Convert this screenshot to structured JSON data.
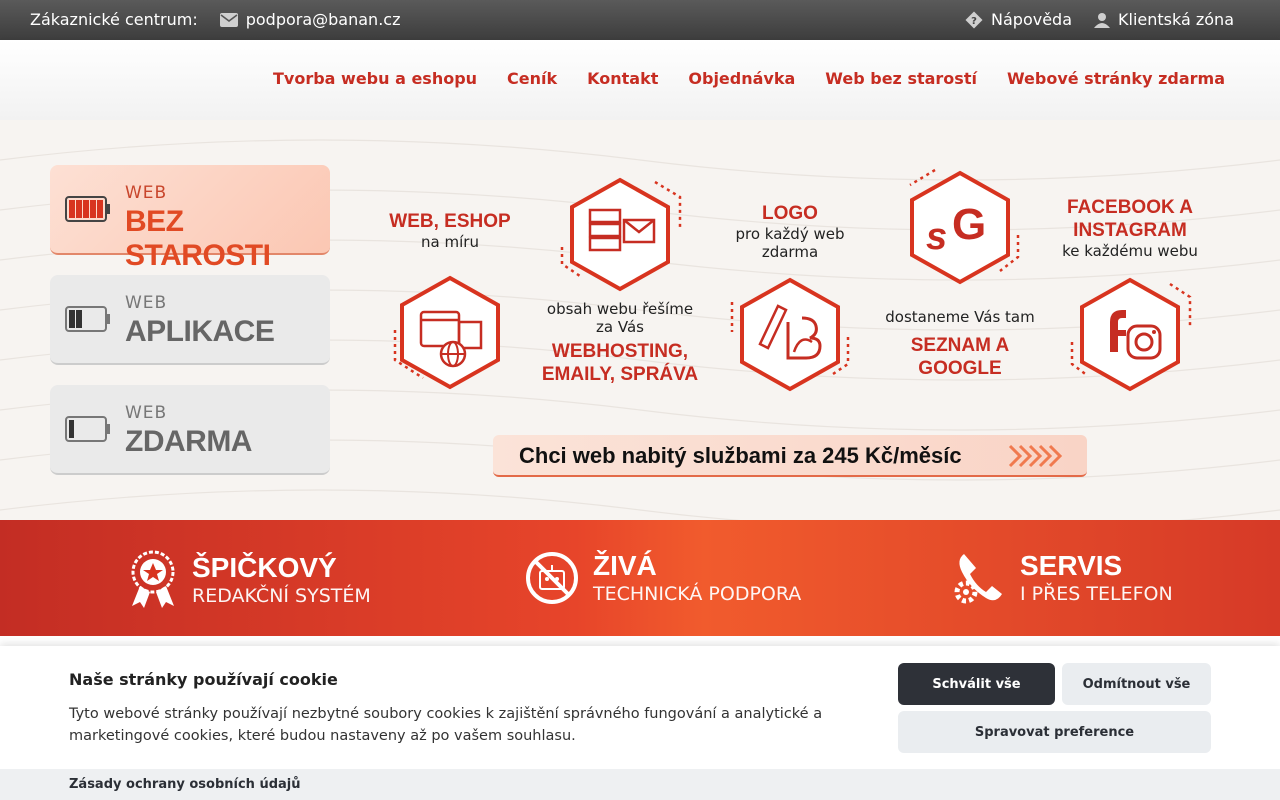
{
  "topbar": {
    "customer_center": "Zákaznické centrum:",
    "email": "podpora@banan.cz",
    "help": "Nápověda",
    "client_zone": "Klientská zóna"
  },
  "nav": {
    "items": [
      "Tvorba webu a eshopu",
      "Ceník",
      "Kontakt",
      "Objednávka",
      "Web bez starostí",
      "Webové stránky zdarma"
    ]
  },
  "tiles": [
    {
      "line1": "WEB",
      "line2": "BEZ STAROSTI"
    },
    {
      "line1": "WEB",
      "line2": "APLIKACE"
    },
    {
      "line1": "WEB",
      "line2": "ZDARMA"
    }
  ],
  "services": {
    "web_eshop": {
      "head": "WEB, ESHOP",
      "sub": "na míru"
    },
    "hosting": {
      "sub1": "obsah webu řešíme",
      "sub2": "za Vás",
      "head1": "WEBHOSTING,",
      "head2": "EMAILY, SPRÁVA"
    },
    "logo": {
      "head": "LOGO",
      "sub1": "pro každý web",
      "sub2": "zdarma"
    },
    "seo": {
      "sub": "dostaneme Vás tam",
      "head1": "SEZNAM A",
      "head2": "GOOGLE"
    },
    "social": {
      "head1": "FACEBOOK A",
      "head2": "INSTAGRAM",
      "sub": "ke každému webu"
    }
  },
  "cta": {
    "label": "Chci web nabitý službami za 245 Kč/měsíc"
  },
  "features": [
    {
      "title": "ŠPIČKOVÝ",
      "sub": "REDAKČNÍ SYSTÉM"
    },
    {
      "title": "ŽIVÁ",
      "sub": "TECHNICKÁ PODPORA"
    },
    {
      "title": "SERVIS",
      "sub": "I PŘES TELEFON"
    }
  ],
  "cookie": {
    "title": "Naše stránky používají cookie",
    "desc": "Tyto webové stránky používají nezbytné soubory cookies k zajištění správného fungování a analytické a marketingové cookies, které budou nastaveny až po vašem souhlasu.",
    "accept_all": "Schválit vše",
    "reject_all": "Odmítnout vše",
    "manage": "Spravovat preference",
    "privacy": "Zásady ochrany osobních údajů"
  },
  "colors": {
    "brand_red": "#c62d22",
    "accent_orange": "#e14a24",
    "dark_button": "#2e3138"
  }
}
